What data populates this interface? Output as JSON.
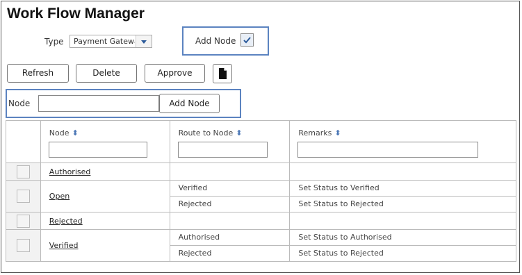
{
  "page": {
    "title": "Work Flow Manager"
  },
  "filters": {
    "type_label": "Type",
    "type_value": "Payment Gateway",
    "add_node_label": "Add Node",
    "add_node_checked": true
  },
  "toolbar": {
    "refresh": "Refresh",
    "delete": "Delete",
    "approve": "Approve",
    "doc_icon": "document-icon"
  },
  "add_node_form": {
    "node_label": "Node",
    "node_value": "",
    "add_button": "Add Node"
  },
  "table": {
    "columns": [
      {
        "label": "Node"
      },
      {
        "label": "Route to Node"
      },
      {
        "label": "Remarks"
      }
    ],
    "rows": [
      {
        "node": "Authorised",
        "routes": []
      },
      {
        "node": "Open",
        "routes": [
          {
            "route": "Verified",
            "remark": "Set Status to Verified"
          },
          {
            "route": "Rejected",
            "remark": "Set Status to Rejected"
          }
        ]
      },
      {
        "node": "Rejected",
        "routes": []
      },
      {
        "node": "Verified",
        "routes": [
          {
            "route": "Authorised",
            "remark": "Set Status to Authorised"
          },
          {
            "route": "Rejected",
            "remark": "Set Status to Rejected"
          }
        ]
      }
    ]
  },
  "colors": {
    "highlight": "#5b83c0",
    "sort_icon": "#4a76b5"
  }
}
